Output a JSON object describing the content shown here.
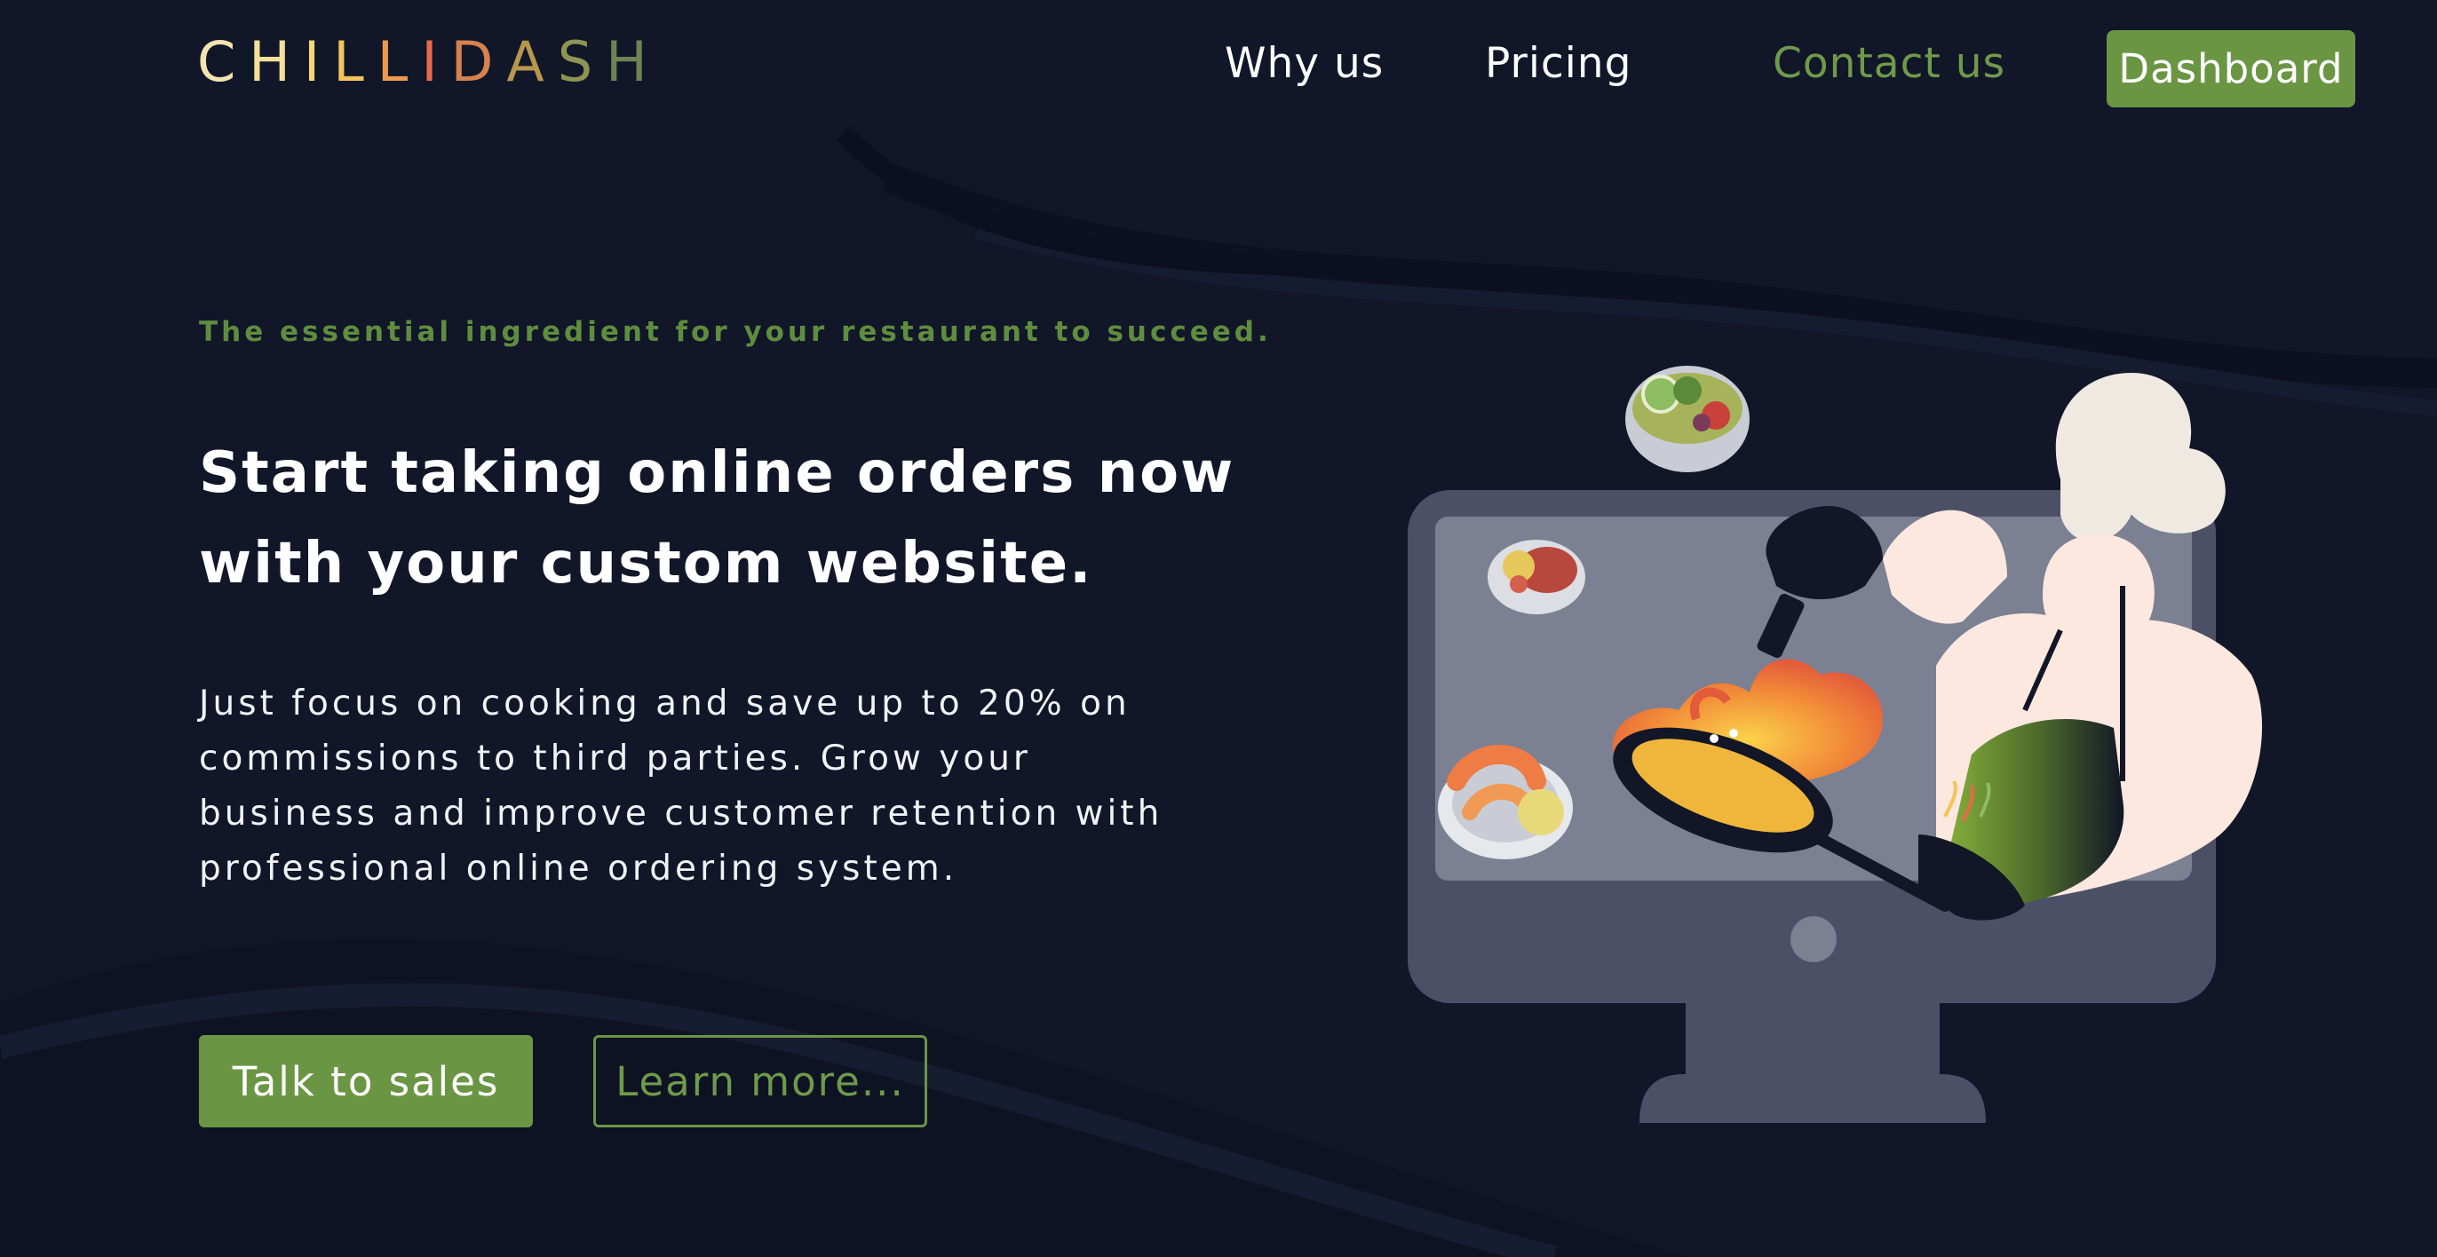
{
  "brand": {
    "logo_letters": [
      {
        "char": "C",
        "color": "#f3e3b0"
      },
      {
        "char": "H",
        "color": "#f4e09a"
      },
      {
        "char": "I",
        "color": "#f4d77a"
      },
      {
        "char": "L",
        "color": "#f2c45a"
      },
      {
        "char": "L",
        "color": "#ee9a4e"
      },
      {
        "char": "I",
        "color": "#e86a4a"
      },
      {
        "char": "D",
        "color": "#d6824e"
      },
      {
        "char": "A",
        "color": "#b7964e"
      },
      {
        "char": "S",
        "color": "#8e9552"
      },
      {
        "char": "H",
        "color": "#6f8454"
      }
    ]
  },
  "nav": {
    "why_us": "Why us",
    "pricing": "Pricing",
    "contact_us": "Contact us",
    "dashboard": "Dashboard"
  },
  "hero": {
    "tagline": "The essential ingredient for your restaurant to succeed.",
    "headline": "Start taking online orders now with your custom website.",
    "description": "Just focus on cooking and save up to 20% on commissions to third parties. Grow your business and improve customer retention with professional online ordering system.",
    "cta_primary": "Talk to sales",
    "cta_secondary": "Learn more..."
  },
  "colors": {
    "background": "#111628",
    "accent_green": "#6a9644",
    "text_green": "#6f9a4b",
    "text_white": "#ffffff"
  },
  "illustration": {
    "subject": "chef-cooking-through-computer-monitor",
    "icons": [
      "salad-bowl-icon",
      "steak-plate-icon",
      "shrimp-plate-icon",
      "frying-pan-icon",
      "chili-logo-icon"
    ]
  }
}
